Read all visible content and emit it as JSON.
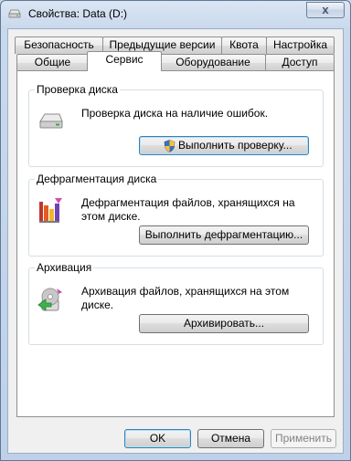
{
  "window": {
    "title": "Свойства: Data (D:)",
    "close_glyph": "x"
  },
  "tabs": {
    "row_top": [
      "Безопасность",
      "Предыдущие версии",
      "Квота",
      "Настройка"
    ],
    "row_bottom": [
      "Общие",
      "Сервис",
      "Оборудование",
      "Доступ"
    ],
    "selected": "Сервис"
  },
  "groups": {
    "check": {
      "label": "Проверка диска",
      "text": "Проверка диска на наличие ошибок.",
      "button": "Выполнить проверку...",
      "icon": "drive-icon"
    },
    "defrag": {
      "label": "Дефрагментация диска",
      "text": "Дефрагментация файлов, хранящихся на этом диске.",
      "button": "Выполнить дефрагментацию...",
      "icon": "defrag-icon"
    },
    "backup": {
      "label": "Архивация",
      "text": "Архивация файлов, хранящихся на этом диске.",
      "button": "Архивировать...",
      "icon": "backup-icon"
    }
  },
  "footer": {
    "ok": "OK",
    "cancel": "Отмена",
    "apply": "Применить"
  }
}
